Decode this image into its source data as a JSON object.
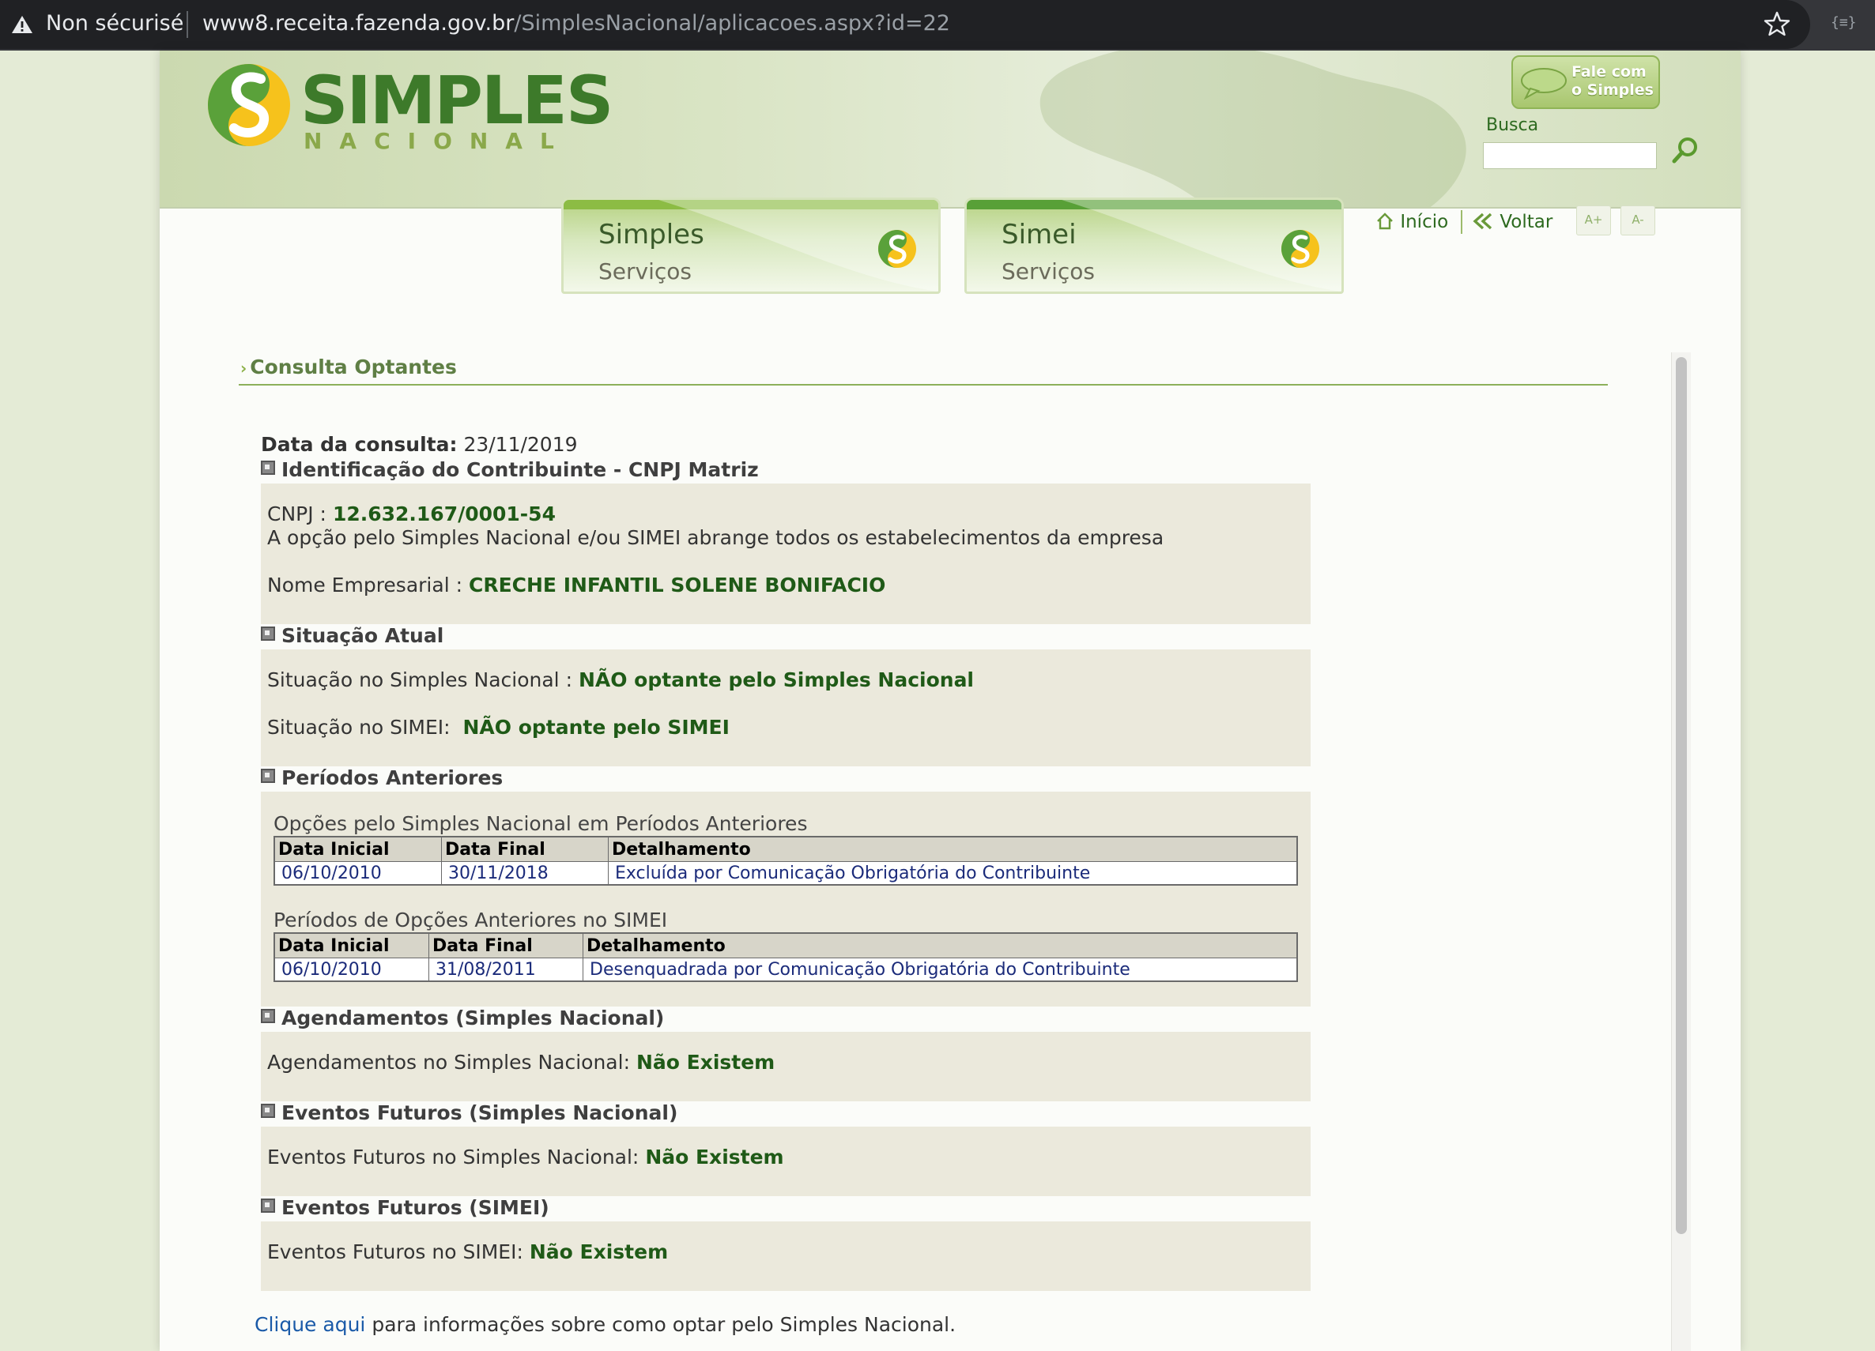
{
  "browser": {
    "security_label": "Non sécurisé",
    "url_host": "www8.receita.fazenda.gov.br",
    "url_path": "/SimplesNacional/aplicacoes.aspx?id=22",
    "extension_label": "{≡}"
  },
  "header": {
    "logo_title": "SIMPLES",
    "logo_subtitle": "NACIONAL",
    "fale_line1": "Fale com",
    "fale_line2": "o Simples",
    "busca_label": "Busca",
    "busca_value": ""
  },
  "tabs": [
    {
      "title": "Simples",
      "subtitle": "Serviços"
    },
    {
      "title": "Simei",
      "subtitle": "Serviços"
    }
  ],
  "toplinks": {
    "inicio": "Início",
    "voltar": "Voltar",
    "font_plus": "A+",
    "font_minus": "A-"
  },
  "page": {
    "section_title": "Consulta Optantes",
    "data_label": "Data da consulta:",
    "data_value": "23/11/2019",
    "identificacao": {
      "header": "Identificação do Contribuinte - CNPJ Matriz",
      "cnpj_label": "CNPJ :",
      "cnpj_value": "12.632.167/0001-54",
      "abrange_text": "A opção pelo Simples Nacional e/ou SIMEI abrange todos os estabelecimentos da empresa",
      "nome_label": "Nome Empresarial :",
      "nome_value": "CRECHE INFANTIL SOLENE BONIFACIO"
    },
    "situacao": {
      "header": "Situação Atual",
      "simples_label": "Situação no Simples Nacional :",
      "simples_value": "NÃO optante pelo Simples Nacional",
      "simei_label": "Situação no SIMEI:",
      "simei_value": "NÃO optante pelo SIMEI"
    },
    "periodos": {
      "header": "Períodos Anteriores",
      "simples_caption": "Opções pelo Simples Nacional em Períodos Anteriores",
      "simples_columns": [
        "Data Inicial",
        "Data Final",
        "Detalhamento"
      ],
      "simples_rows": [
        [
          "06/10/2010",
          "30/11/2018",
          "Excluída por Comunicação Obrigatória do Contribuinte"
        ]
      ],
      "simei_caption": "Períodos de Opções Anteriores no SIMEI",
      "simei_columns": [
        "Data Inicial",
        "Data Final",
        "Detalhamento"
      ],
      "simei_rows": [
        [
          "06/10/2010",
          "31/08/2011",
          "Desenquadrada por Comunicação Obrigatória do Contribuinte"
        ]
      ]
    },
    "agendamentos": {
      "header": "Agendamentos (Simples Nacional)",
      "label": "Agendamentos no Simples Nacional:",
      "value": "Não Existem"
    },
    "eventos_simples": {
      "header": "Eventos Futuros (Simples Nacional)",
      "label": "Eventos Futuros no Simples Nacional:",
      "value": "Não Existem"
    },
    "eventos_simei": {
      "header": "Eventos Futuros (SIMEI)",
      "label": "Eventos Futuros no SIMEI:",
      "value": "Não Existem"
    },
    "footer_link": "Clique aqui",
    "footer_text": " para informações sobre como optar pelo Simples Nacional."
  },
  "colors": {
    "brand_green": "#3d7a2a",
    "value_green": "#1f5a17",
    "box_bg": "#ebe9dc",
    "link_blue": "#1a5aa8"
  }
}
